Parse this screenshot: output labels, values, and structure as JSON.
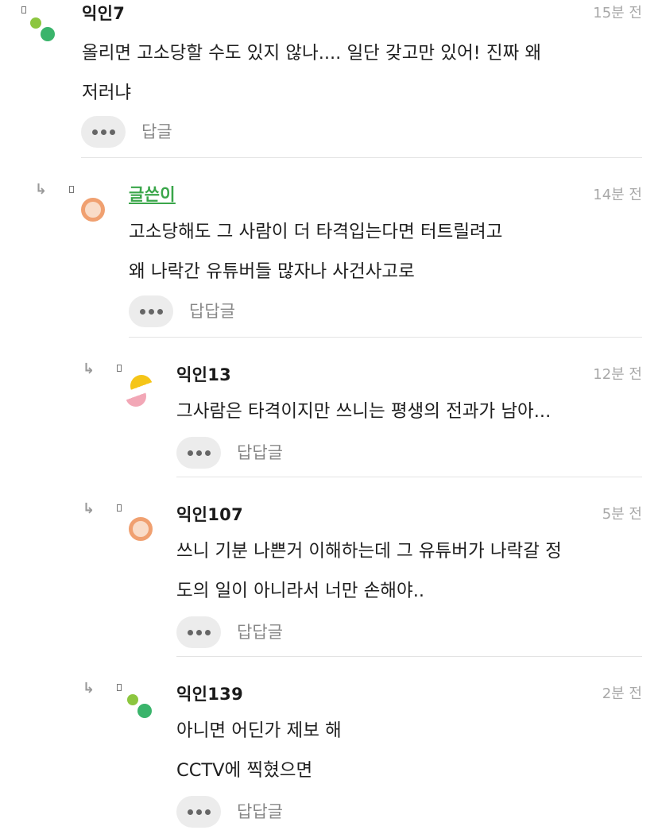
{
  "comments": [
    {
      "author": "익인7",
      "time": "15분 전",
      "lines": [
        "올리면 고소당할 수도 있지 않나.... 일단 갖고만 있어! 진짜 왜",
        "저러냐"
      ],
      "reply_label": "답글",
      "avatar": {
        "type": "dots",
        "color1": "#8cc63f",
        "color2": "#3ab46b"
      }
    },
    {
      "author": "글쓴이",
      "time": "14분 전",
      "lines": [
        "고소당해도 그 사람이 더 타격입는다면 터트릴려고",
        "왜 나락간 유튜버들 많자나 사건사고로"
      ],
      "reply_label": "답답글",
      "avatar": {
        "type": "ring",
        "color": "#f0a070"
      }
    },
    {
      "author": "익인13",
      "time": "12분 전",
      "lines": [
        "그사람은 타격이지만 쓰니는 평생의 전과가 남아..."
      ],
      "reply_label": "답답글",
      "avatar": {
        "type": "halves",
        "color1": "#f5c518",
        "color2": "#f2a7b6"
      }
    },
    {
      "author": "익인107",
      "time": "5분 전",
      "lines": [
        "쓰니 기분 나쁜거 이해하는데 그 유튜버가 나락갈 정",
        "도의 일이 아니라서 너만 손해야.."
      ],
      "reply_label": "답답글",
      "avatar": {
        "type": "ring",
        "color": "#f0a070"
      }
    },
    {
      "author": "익인139",
      "time": "2분 전",
      "lines": [
        "아니면 어딘가 제보 해",
        "CCTV에 찍혔으면"
      ],
      "reply_label": "답답글",
      "avatar": {
        "type": "dots",
        "color1": "#8cc63f",
        "color2": "#3ab46b"
      }
    }
  ],
  "icons": {
    "reply_arrow": "reply-arrow-icon",
    "more": "more-dots-icon"
  },
  "colors": {
    "op_name": "#3aa64a",
    "time": "#a8a8a8",
    "button_bg": "#ececec"
  }
}
